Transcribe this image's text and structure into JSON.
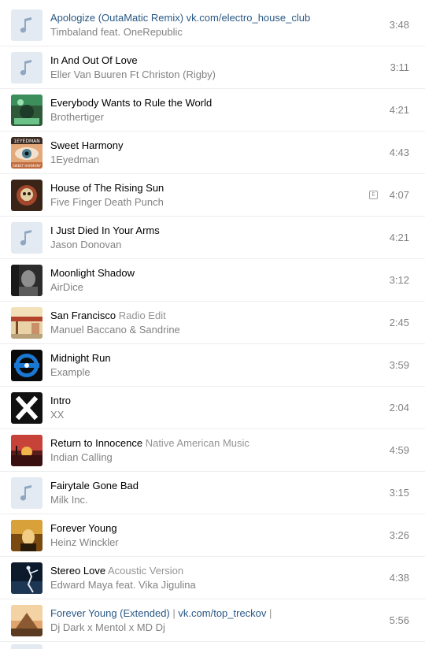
{
  "tracks": [
    {
      "title": "Apologize (OutaMatic Remix) vk.com/electro_house_club",
      "subtitle": "",
      "artist": "Timbaland feat. OneRepublic",
      "duration": "3:48",
      "cover": "note-icon",
      "link": true
    },
    {
      "title": "In And Out Of Love",
      "subtitle": "",
      "artist": "Eller Van Buuren Ft Christon (Rigby)",
      "duration": "3:11",
      "cover": "note-icon"
    },
    {
      "title": "Everybody Wants to Rule the World",
      "subtitle": "",
      "artist": "Brothertiger",
      "duration": "4:21",
      "cover": "album-art"
    },
    {
      "title": "Sweet Harmony",
      "subtitle": "",
      "artist": "1Eyedman",
      "duration": "4:43",
      "cover": "eye-art",
      "cover_text": "1EYEDMAN",
      "cover_subtext": "SWEET HARMONY"
    },
    {
      "title": "House of The Rising Sun",
      "subtitle": "",
      "artist": "Five Finger Death Punch",
      "duration": "4:07",
      "cover": "skull-art",
      "explicit": "E"
    },
    {
      "title": "I Just Died In Your Arms",
      "subtitle": "",
      "artist": "Jason Donovan",
      "duration": "4:21",
      "cover": "note-icon"
    },
    {
      "title": "Moonlight Shadow",
      "subtitle": "",
      "artist": "AirDice",
      "duration": "3:12",
      "cover": "portrait-art"
    },
    {
      "title": "San Francisco",
      "subtitle": "Radio Edit",
      "artist": "Manuel Baccano & Sandrine",
      "duration": "2:45",
      "cover": "sf-art"
    },
    {
      "title": "Midnight Run",
      "subtitle": "",
      "artist": "Example",
      "duration": "3:59",
      "cover": "disc-art"
    },
    {
      "title": "Intro",
      "subtitle": "",
      "artist": "XX",
      "duration": "2:04",
      "cover": "x-art"
    },
    {
      "title": "Return to Innocence",
      "subtitle": "Native American Music",
      "artist": "Indian Calling",
      "duration": "4:59",
      "cover": "sunset-art"
    },
    {
      "title": "Fairytale Gone Bad",
      "subtitle": "",
      "artist": "Milk Inc.",
      "duration": "3:15",
      "cover": "note-icon"
    },
    {
      "title": "Forever Young",
      "subtitle": "",
      "artist": "Heinz Winckler",
      "duration": "3:26",
      "cover": "gold-art"
    },
    {
      "title": "Stereo Love",
      "subtitle": "Acoustic Version",
      "artist": "Edward Maya feat. Vika Jigulina",
      "duration": "4:38",
      "cover": "dancer-art"
    },
    {
      "title": "Forever Young (Extended)",
      "title_extra": "vk.com/top_treckov",
      "separator": "|",
      "artist": "Dj Dark x Mentol x MD Dj",
      "duration": "5:56",
      "cover": "pyramid-art",
      "link": true
    }
  ],
  "colors": {
    "link": "#2a5885",
    "placeholder_bg": "#e4eaf1",
    "placeholder_note": "#8fa7c3",
    "muted": "#828282"
  }
}
